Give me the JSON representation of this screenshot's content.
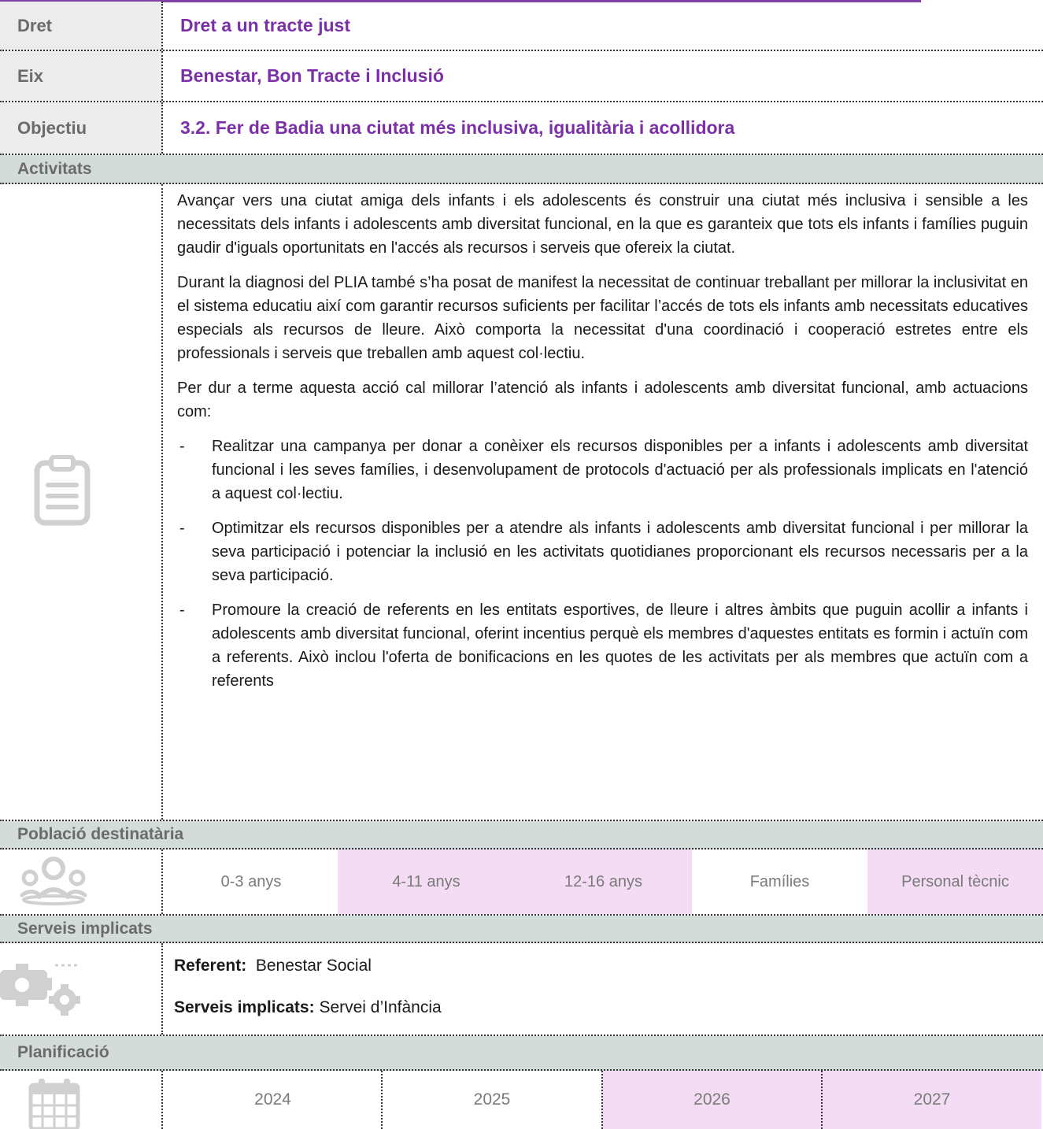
{
  "header_rows": [
    {
      "label": "Dret",
      "value": "Dret a un tracte just"
    },
    {
      "label": "Eix",
      "value": "Benestar, Bon Tracte i Inclusió"
    },
    {
      "label": "Objectiu",
      "value": "3.2. Fer de Badia una ciutat més inclusiva, igualitària i acollidora"
    }
  ],
  "activitats": {
    "title": "Activitats",
    "icon": "clipboard-icon",
    "paragraphs": [
      "Avançar vers una ciutat amiga dels infants i els adolescents és construir una ciutat més inclusiva i sensible a les necessitats dels infants i adolescents amb diversitat funcional, en la que es garanteix que tots els infants i famílies puguin gaudir d'iguals oportunitats en l'accés als recursos i serveis que ofereix la ciutat.",
      "Durant la diagnosi del PLIA també s’ha posat de manifest la necessitat de continuar treballant per millorar la inclusivitat en el sistema educatiu així com garantir recursos suficients per facilitar l’accés de tots els infants amb necessitats educatives especials als recursos de lleure. Això comporta la necessitat d'una coordinació i cooperació estretes entre els professionals i serveis que treballen amb aquest col·lectiu.",
      "Per dur a terme aquesta acció cal millorar l’atenció als infants i adolescents amb diversitat funcional, amb actuacions com:"
    ],
    "bullet_marker": "-",
    "bullets": [
      "Realitzar una campanya per donar a conèixer els recursos disponibles per a infants i adolescents amb diversitat funcional i les seves famílies, i desenvolupament de protocols d'actuació per als professionals implicats en l'atenció a aquest col·lectiu.",
      "Optimitzar els recursos disponibles per a atendre als infants i adolescents amb diversitat funcional i per millorar la seva participació i potenciar la inclusió en les activitats quotidianes proporcionant els recursos necessaris per a la seva participació.",
      "Promoure la creació de referents en les entitats esportives, de lleure i altres àmbits que puguin acollir a infants i adolescents amb diversitat funcional, oferint incentius perquè els membres d'aquestes entitats es formin i actuïn com a referents. Això inclou l'oferta de bonificacions en les quotes de les activitats per als membres que actuïn com a referents"
    ]
  },
  "poblacio": {
    "title": "Població destinatària",
    "icon": "people-group-icon",
    "groups": [
      {
        "label": "0-3 anys",
        "selected": false
      },
      {
        "label": "4-11 anys",
        "selected": true
      },
      {
        "label": "12-16 anys",
        "selected": true
      },
      {
        "label": "Famílies",
        "selected": false
      },
      {
        "label": "Personal tècnic",
        "selected": true
      }
    ]
  },
  "serveis": {
    "title": "Serveis implicats",
    "icon": "gears-icon",
    "referent_label": "Referent:",
    "referent_value": "Benestar Social",
    "implicats_label": "Serveis implicats:",
    "implicats_value": "Servei d’Infància"
  },
  "planificacio": {
    "title": "Planificació",
    "icon": "calendar-icon",
    "years": [
      {
        "label": "2024",
        "selected": false
      },
      {
        "label": "2025",
        "selected": false
      },
      {
        "label": "2026",
        "selected": true
      },
      {
        "label": "2027",
        "selected": true
      }
    ]
  },
  "colors": {
    "accent": "#7b30a8",
    "highlight": "#f3dcf4",
    "section_bg": "#d3dcd8",
    "label_bg": "#ececec"
  }
}
